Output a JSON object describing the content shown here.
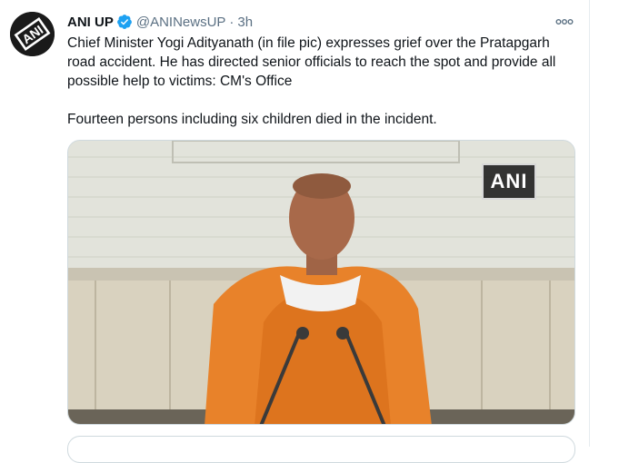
{
  "tweet": {
    "account_name": "ANI UP",
    "handle": "@ANINewsUP",
    "separator": "·",
    "time": "3h",
    "paragraph_1": "Chief Minister Yogi Adityanath (in file pic) expresses grief over the Pratapgarh road accident. He has directed senior officials to reach the spot and provide all possible help to victims: CM's Office",
    "paragraph_2": "Fourteen persons including six children died in the incident.",
    "media_watermark": "ANI",
    "avatar_logo_text": "ANI"
  },
  "icons": {
    "verified": "verified-badge-icon",
    "more": "more-horizontal-icon"
  },
  "colors": {
    "verified_blue": "#1da1f2",
    "secondary_text": "#5b7083",
    "robe_saffron": "#e8822a"
  }
}
